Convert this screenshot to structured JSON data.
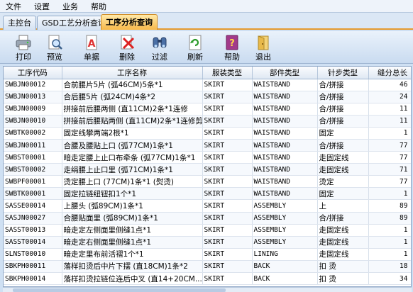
{
  "menu": [
    "文件",
    "设置",
    "业务",
    "帮助"
  ],
  "tabs": [
    "主控台",
    "GSD工艺分析查询",
    "工序分析查询"
  ],
  "toolbar": {
    "print": "打印",
    "preview": "预览",
    "report": "单据",
    "delete": "删除",
    "filter": "过滤",
    "refresh": "刷新",
    "help": "帮助",
    "exit": "退出"
  },
  "table": {
    "columns": [
      "工序代码",
      "工序名称",
      "服装类型",
      "部件类型",
      "针步类型",
      "缝分总长"
    ],
    "rows": [
      [
        "SWBJN00012",
        "合前腰片5片 (弧46CM)5条*1",
        "SKIRT",
        "WAISTBAND",
        "合/拼接",
        "46"
      ],
      [
        "SWBJN00013",
        "合后腰5片 (弧24CM)4条*2",
        "SKIRT",
        "WAISTBAND",
        "合/拼接",
        "24"
      ],
      [
        "SWBJN00009",
        "拼接前后腰两侧 (直11CM)2条*1连修",
        "SKIRT",
        "WAISTBAND",
        "合/拼接",
        "11"
      ],
      [
        "SWBJN00010",
        "拼接前后腰贴两侧 (直11CM)2条*1连修剪",
        "SKIRT",
        "WAISTBAND",
        "合/拼接",
        "11"
      ],
      [
        "SWBTK00002",
        "固定线攀两端2根*1",
        "SKIRT",
        "WAISTBAND",
        "固定",
        "1"
      ],
      [
        "SWBJN00011",
        "合腰及腰贴上口 (弧77CM)1条*1",
        "SKIRT",
        "WAISTBAND",
        "合/拼接",
        "77"
      ],
      [
        "SWBST00001",
        "暗走定腰上止口布牵条 (弧77CM)1条*1",
        "SKIRT",
        "WAISTBAND",
        "走固定线",
        "77"
      ],
      [
        "SWBST00002",
        "走绢腰上止口里 (弧71CM)1条*1",
        "SKIRT",
        "WAISTBAND",
        "走固定线",
        "71"
      ],
      [
        "SWBPF00001",
        "烫定腰上口 (77CM)1条*1 (熨烫)",
        "SKIRT",
        "WAISTBAND",
        "烫定",
        "77"
      ],
      [
        "SWBTK00001",
        "固定拉链纽钮扣1个*1",
        "SKIRT",
        "WAISTBAND",
        "固定",
        "1"
      ],
      [
        "SASSE00014",
        "上腰头 (弧89CM)1条*1",
        "SKIRT",
        "ASSEMBLY",
        "上",
        "89"
      ],
      [
        "SASJN00027",
        "合腰贴面里 (弧89CM)1条*1",
        "SKIRT",
        "ASSEMBLY",
        "合/拼接",
        "89"
      ],
      [
        "SASST00013",
        "暗走定左侧面里侧缝1点*1",
        "SKIRT",
        "ASSEMBLY",
        "走固定线",
        "1"
      ],
      [
        "SASST00014",
        "暗走定右侧面里侧缝1点*1",
        "SKIRT",
        "ASSEMBLY",
        "走固定线",
        "1"
      ],
      [
        "SLNST00010",
        "暗走定里布前活褶1个*1",
        "SKIRT",
        "LINING",
        "走固定线",
        "1"
      ],
      [
        "SBKPH00011",
        "落样扣烫后中片下摆 (直18CM)1条*2",
        "SKIRT",
        "BACK",
        "扣 烫",
        "18"
      ],
      [
        "SBKPH00014",
        "落样扣烫拉链位连后中叉 (直14+20CM...",
        "SKIRT",
        "BACK",
        "扣 烫",
        "34"
      ]
    ]
  }
}
